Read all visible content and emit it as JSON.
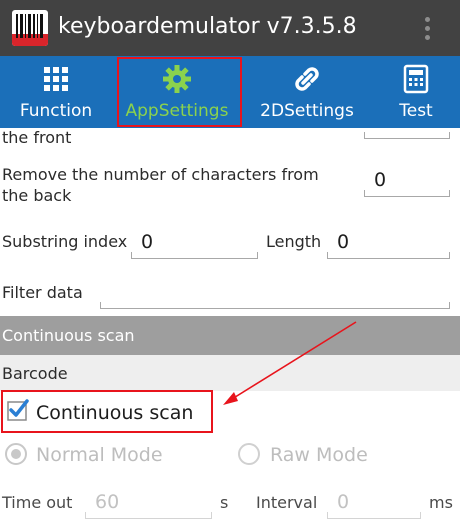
{
  "app": {
    "title": "keyboardemulator v7.3.5.8",
    "icon": "barcode-app-icon",
    "overflow_icon": "more-vertical-icon"
  },
  "tabs": [
    {
      "label": "Function",
      "icon": "grid-icon",
      "active": false
    },
    {
      "label": "AppSettings",
      "icon": "gear-icon",
      "active": true
    },
    {
      "label": "2DSettings",
      "icon": "link-icon",
      "active": false
    },
    {
      "label": "Test",
      "icon": "calculator-icon",
      "active": false
    }
  ],
  "settings": {
    "remove_front_label_tail": "the front",
    "remove_back_label_line1": "Remove the number of characters from",
    "remove_back_label_line2": "the back",
    "remove_back_value": "0",
    "substring_index_label": "Substring index",
    "substring_index_value": "0",
    "length_label": "Length",
    "length_value": "0",
    "filter_data_label": "Filter data",
    "filter_data_value": ""
  },
  "continuous_scan": {
    "section_title": "Continuous scan",
    "subsection_title": "Barcode",
    "checkbox_label": "Continuous scan",
    "checkbox_checked": true,
    "mode_normal_label": "Normal Mode",
    "mode_raw_label": "Raw Mode",
    "timeout_label": "Time out",
    "timeout_value": "60",
    "timeout_unit": "s",
    "interval_label": "Interval",
    "interval_value": "0",
    "interval_unit": "ms"
  },
  "colors": {
    "tab_bar": "#1b6fb9",
    "title_bar": "#424242",
    "active_tab": "#8bd24d",
    "highlight": "#e8141c",
    "checkbox": "#2a7fd4"
  }
}
